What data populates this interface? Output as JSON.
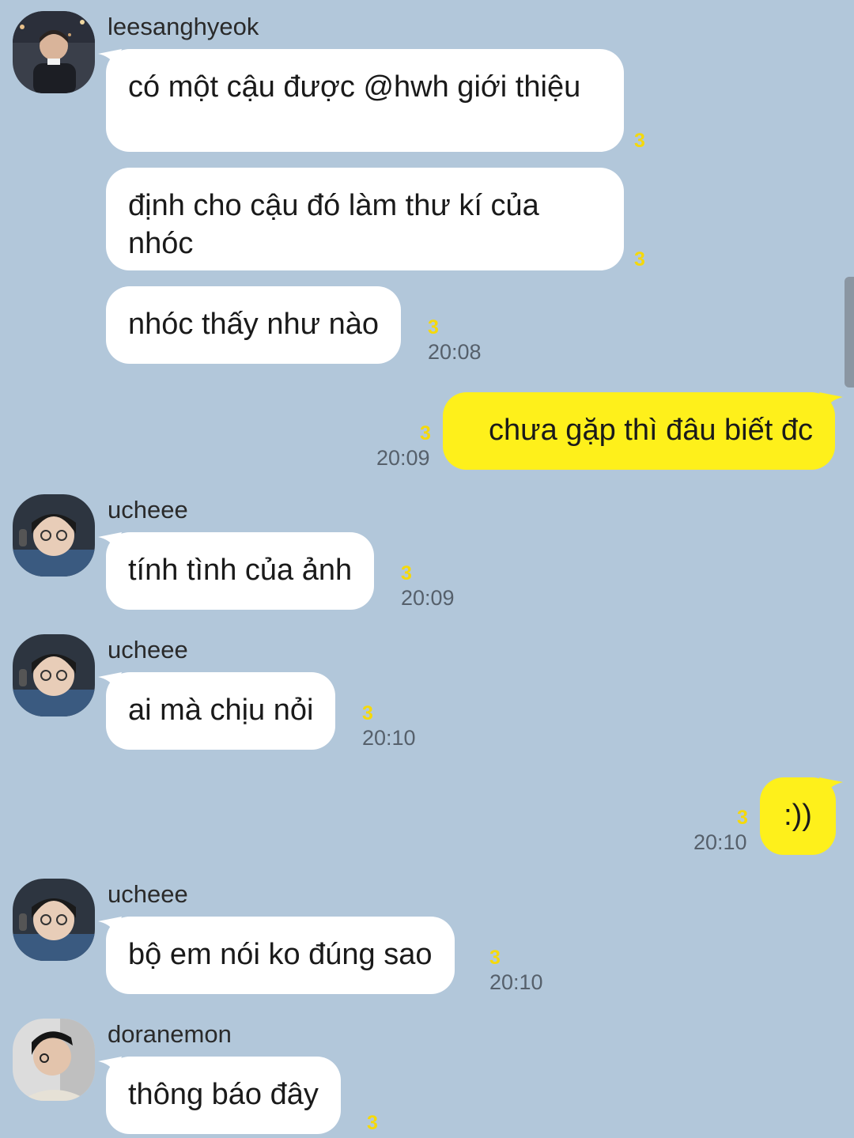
{
  "messages": [
    {
      "sender": "leesanghyeok",
      "text": "có một cậu được @hwh giới thiệu",
      "unread": "3"
    },
    {
      "text": "định cho cậu đó làm thư kí của nhóc",
      "unread": "3"
    },
    {
      "text": "nhóc thấy như nào",
      "unread": "3",
      "time": "20:08"
    },
    {
      "text": "chưa gặp thì đâu biết đc",
      "unread": "3",
      "time": "20:09",
      "mine": true
    },
    {
      "sender": "ucheee",
      "text": "tính tình của ảnh",
      "unread": "3",
      "time": "20:09"
    },
    {
      "sender": "ucheee",
      "text": "ai mà chịu nỏi",
      "unread": "3",
      "time": "20:10"
    },
    {
      "text": ":))",
      "unread": "3",
      "time": "20:10",
      "mine": true
    },
    {
      "sender": "ucheee",
      "text": "bộ em nói ko đúng sao",
      "unread": "3",
      "time": "20:10"
    },
    {
      "sender": "doranemon",
      "text": "thông báo đây",
      "unread": "3"
    }
  ],
  "colors": {
    "background": "#b2c7da",
    "incoming_bubble": "#ffffff",
    "outgoing_bubble": "#fef01b",
    "unread_count": "#f5d90a"
  },
  "icons": {
    "avatar_leesanghyeok": "profile-photo",
    "avatar_ucheee": "profile-photo",
    "avatar_doranemon": "profile-photo"
  }
}
